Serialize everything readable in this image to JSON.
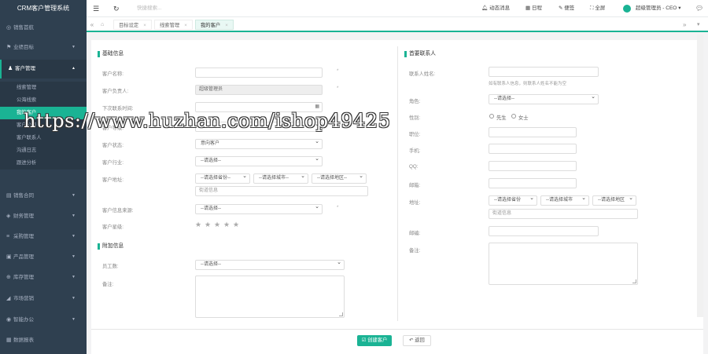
{
  "app": {
    "title": "CRM客户管理系统",
    "accent": "#1ab394",
    "sidebar_bg": "#2f4050"
  },
  "sidebar": {
    "items": [
      {
        "icon": "compass-icon",
        "label": "销售首航"
      },
      {
        "icon": "flag-icon",
        "label": "业绩目标"
      },
      {
        "icon": "user-icon",
        "label": "客户管理"
      },
      {
        "icon": "cart-icon",
        "label": "销售合同"
      },
      {
        "icon": "money-icon",
        "label": "财务管理"
      },
      {
        "icon": "purchase-icon",
        "label": "采购管理"
      },
      {
        "icon": "box-icon",
        "label": "产品管理"
      },
      {
        "icon": "warehouse-icon",
        "label": "库存管理"
      },
      {
        "icon": "chart-icon",
        "label": "市场营销"
      },
      {
        "icon": "office-icon",
        "label": "智能办公"
      },
      {
        "icon": "report-icon",
        "label": "数据报表"
      }
    ],
    "sub_items": [
      "线索管理",
      "公海线索",
      "我的客户",
      "客户公海",
      "客户联系人",
      "沟通日志",
      "跟进分析"
    ]
  },
  "topbar": {
    "menu_icon": "menu-icon",
    "refresh_icon": "refresh-icon",
    "search_placeholder": "快捷搜索...",
    "notice": "动态消息",
    "calendar": "日程",
    "notes": "便签",
    "fullscreen": "全屏",
    "user": "超级管理员 - CEO"
  },
  "tabs": [
    "首页",
    "目标设定",
    "线索管理",
    "我的客户"
  ],
  "form": {
    "basic_title": "基础信息",
    "customer_name_label": "客户名称:",
    "owner_label": "客户负责人:",
    "owner_value": "超级管理员",
    "next_contact_label": "下次联系时间:",
    "level_label": "客户等级:",
    "status_label": "客户状态:",
    "status_value": "意向客户",
    "industry_label": "客户行业:",
    "industry_value": "--请选择--",
    "address_label": "客户地址:",
    "province_placeholder": "--请选择省份--",
    "city_placeholder": "--请选择城市--",
    "district_placeholder": "--请选择地区--",
    "street_placeholder": "街道信息",
    "source_label": "客户信息来源:",
    "source_value": "--请选择--",
    "star_label": "客户星级:",
    "extra_title": "附加信息",
    "staff_label": "员工数:",
    "staff_value": "--请选择--",
    "remark_label": "备注:",
    "required_mark": "*"
  },
  "contact": {
    "title": "首要联系人",
    "name_label": "联系人姓名:",
    "name_hint": "如有联系人信息，则联系人姓名不能为空",
    "role_label": "角色:",
    "role_value": "--请选择--",
    "gender_label": "性别:",
    "male": "先生",
    "female": "女士",
    "position_label": "职位:",
    "mobile_label": "手机:",
    "qq_label": "QQ:",
    "email_label": "邮箱:",
    "address_label": "地址:",
    "province_placeholder": "--请选择省份",
    "city_placeholder": "--请选择城市",
    "district_placeholder": "--请选择地区",
    "street_placeholder": "街道信息",
    "zip_label": "邮编:",
    "remark_label": "备注:"
  },
  "buttons": {
    "create": "创建客户",
    "back": "返回"
  },
  "watermark": "https://www.huzhan.com/ishop49425"
}
